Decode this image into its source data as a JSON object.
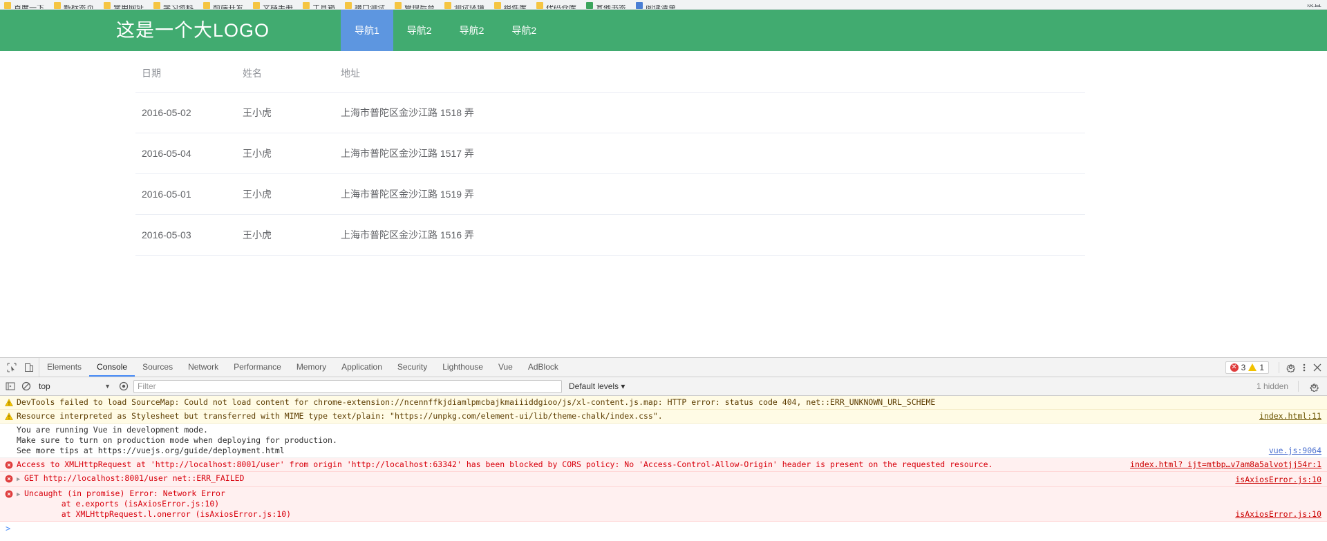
{
  "browser": {
    "bookmarks": [
      {
        "label": "百度一下",
        "color": "yellow"
      },
      {
        "label": "新标签页",
        "color": "yellow"
      },
      {
        "label": "常用网址",
        "color": "yellow"
      },
      {
        "label": "学习资料",
        "color": "yellow"
      },
      {
        "label": "前端开发",
        "color": "yellow"
      },
      {
        "label": "文档手册",
        "color": "yellow"
      },
      {
        "label": "工具箱",
        "color": "yellow"
      },
      {
        "label": "接口测试",
        "color": "yellow"
      },
      {
        "label": "管理后台",
        "color": "yellow"
      },
      {
        "label": "测试环境",
        "color": "yellow"
      },
      {
        "label": "组件库",
        "color": "yellow"
      },
      {
        "label": "代码仓库",
        "color": "yellow"
      },
      {
        "label": "其他书签",
        "color": "green"
      },
      {
        "label": "阅读清单",
        "color": "blue"
      }
    ],
    "right_label": "设置"
  },
  "site": {
    "logo": "这是一个大LOGO",
    "nav": [
      {
        "label": "导航1",
        "active": true
      },
      {
        "label": "导航2",
        "active": false
      },
      {
        "label": "导航2",
        "active": false
      },
      {
        "label": "导航2",
        "active": false
      }
    ],
    "header_bg": "#41ab70",
    "active_nav_bg": "#5d96e0"
  },
  "table": {
    "columns": [
      "日期",
      "姓名",
      "地址"
    ],
    "rows": [
      {
        "date": "2016-05-02",
        "name": "王小虎",
        "address": "上海市普陀区金沙江路 1518 弄"
      },
      {
        "date": "2016-05-04",
        "name": "王小虎",
        "address": "上海市普陀区金沙江路 1517 弄"
      },
      {
        "date": "2016-05-01",
        "name": "王小虎",
        "address": "上海市普陀区金沙江路 1519 弄"
      },
      {
        "date": "2016-05-03",
        "name": "王小虎",
        "address": "上海市普陀区金沙江路 1516 弄"
      }
    ]
  },
  "devtools": {
    "tabs": [
      {
        "label": "Elements",
        "active": false
      },
      {
        "label": "Console",
        "active": true
      },
      {
        "label": "Sources",
        "active": false
      },
      {
        "label": "Network",
        "active": false
      },
      {
        "label": "Performance",
        "active": false
      },
      {
        "label": "Memory",
        "active": false
      },
      {
        "label": "Application",
        "active": false
      },
      {
        "label": "Security",
        "active": false
      },
      {
        "label": "Lighthouse",
        "active": false
      },
      {
        "label": "Vue",
        "active": false
      },
      {
        "label": "AdBlock",
        "active": false
      }
    ],
    "error_count": "3",
    "warning_count": "1",
    "filterbar": {
      "context": "top",
      "filter_placeholder": "Filter",
      "levels": "Default levels ▾",
      "hidden": "1 hidden"
    },
    "messages": [
      {
        "level": "warning",
        "expandable": false,
        "text": "DevTools failed to load SourceMap: Could not load content for chrome-extension://ncennffkjdiamlpmcbajkmaiiiddgioo/js/xl-content.js.map: HTTP error: status code 404, net::ERR_UNKNOWN_URL_SCHEME",
        "link": "chrome-extension://ncennffkjdiamlpmcbajkmaiiiddgioo/js/xl-content.js.map",
        "source": ""
      },
      {
        "level": "warning",
        "expandable": false,
        "text": "Resource interpreted as Stylesheet but transferred with MIME type text/plain: \"https://unpkg.com/element-ui/lib/theme-chalk/index.css\".",
        "link": "https://unpkg.com/element-ui/lib/theme-chalk/index.css",
        "source": "index.html:11"
      },
      {
        "level": "info",
        "expandable": false,
        "text": "You are running Vue in development mode.\nMake sure to turn on production mode when deploying for production.\nSee more tips at https://vuejs.org/guide/deployment.html",
        "link": "https://vuejs.org/guide/deployment.html",
        "source": "vue.js:9064"
      },
      {
        "level": "error",
        "expandable": false,
        "text": "Access to XMLHttpRequest at 'http://localhost:8001/user' from origin 'http://localhost:63342' has been blocked by CORS policy: No 'Access-Control-Allow-Origin' header is present on the requested resource.",
        "link": "",
        "source": "index.html? ijt=mtbp…v7am8a5alvotjj54r:1"
      },
      {
        "level": "error",
        "expandable": true,
        "text": "GET http://localhost:8001/user net::ERR_FAILED",
        "link": "http://localhost:8001/user",
        "source": "isAxiosError.js:10"
      },
      {
        "level": "error",
        "expandable": true,
        "text": "Uncaught (in promise) Error: Network Error",
        "stack": "    at e.exports (isAxiosError.js:10)\n    at XMLHttpRequest.l.onerror (isAxiosError.js:10)",
        "link": "",
        "source": "isAxiosError.js:10"
      }
    ],
    "prompt": ">"
  }
}
